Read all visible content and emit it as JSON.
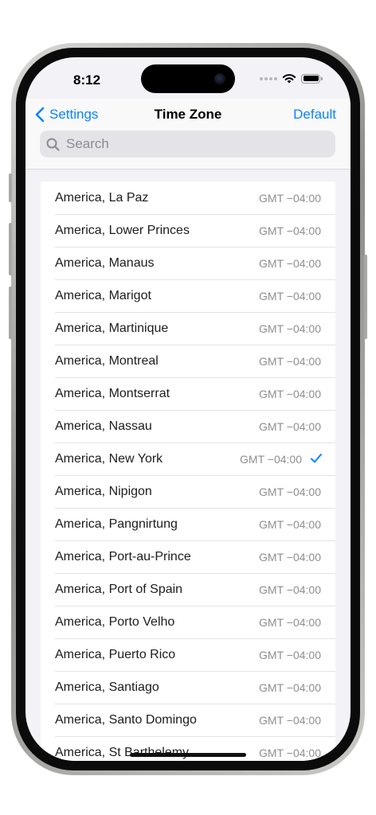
{
  "status_bar": {
    "time": "8:12"
  },
  "nav": {
    "back_label": "Settings",
    "title": "Time Zone",
    "default_label": "Default"
  },
  "search": {
    "placeholder": "Search"
  },
  "timezones": [
    {
      "city": "America, La Paz",
      "offset": "GMT −04:00",
      "selected": false
    },
    {
      "city": "America, Lower Princes",
      "offset": "GMT −04:00",
      "selected": false
    },
    {
      "city": "America, Manaus",
      "offset": "GMT −04:00",
      "selected": false
    },
    {
      "city": "America, Marigot",
      "offset": "GMT −04:00",
      "selected": false
    },
    {
      "city": "America, Martinique",
      "offset": "GMT −04:00",
      "selected": false
    },
    {
      "city": "America, Montreal",
      "offset": "GMT −04:00",
      "selected": false
    },
    {
      "city": "America, Montserrat",
      "offset": "GMT −04:00",
      "selected": false
    },
    {
      "city": "America, Nassau",
      "offset": "GMT −04:00",
      "selected": false
    },
    {
      "city": "America, New York",
      "offset": "GMT −04:00",
      "selected": true
    },
    {
      "city": "America, Nipigon",
      "offset": "GMT −04:00",
      "selected": false
    },
    {
      "city": "America, Pangnirtung",
      "offset": "GMT −04:00",
      "selected": false
    },
    {
      "city": "America, Port-au-Prince",
      "offset": "GMT −04:00",
      "selected": false
    },
    {
      "city": "America, Port of Spain",
      "offset": "GMT −04:00",
      "selected": false
    },
    {
      "city": "America, Porto Velho",
      "offset": "GMT −04:00",
      "selected": false
    },
    {
      "city": "America, Puerto Rico",
      "offset": "GMT −04:00",
      "selected": false
    },
    {
      "city": "America, Santiago",
      "offset": "GMT −04:00",
      "selected": false
    },
    {
      "city": "America, Santo Domingo",
      "offset": "GMT −04:00",
      "selected": false
    },
    {
      "city": "America, St Barthelemy",
      "offset": "GMT −04:00",
      "selected": false
    }
  ],
  "icons": {
    "back": "chevron-left-icon",
    "search": "search-icon",
    "check": "checkmark-icon",
    "wifi": "wifi-icon",
    "battery": "battery-icon",
    "signal": "cellular-signal-icon"
  },
  "colors": {
    "accent": "#0a84ff",
    "background": "#f2f2f7",
    "secondary_text": "#8e8e93"
  }
}
